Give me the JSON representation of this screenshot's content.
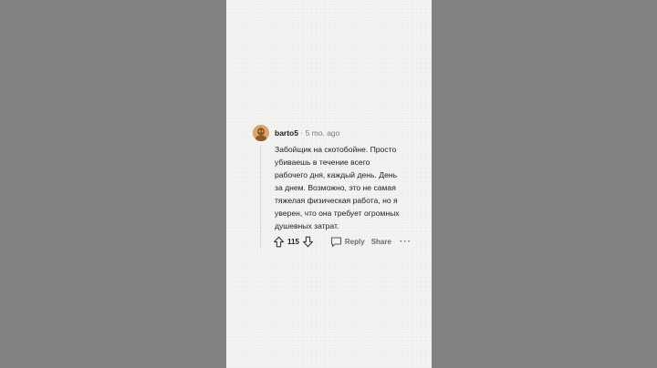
{
  "comment": {
    "username": "barto5",
    "separator": "·",
    "age": "5 mo. ago",
    "body_lines": [
      "Забойщик на скотобойне. Просто",
      "убиваешь в течение всего",
      "рабочего дня, каждый день. День",
      "за днем. Возможно, это не самая",
      "тяжелая физическая работа, но я",
      "уверен, что она требует огромных",
      "душевных затрат."
    ],
    "score": "115",
    "reply_label": "Reply",
    "share_label": "Share",
    "more_label": "···"
  },
  "icons": {
    "avatar": "user-avatar-icon",
    "upvote": "arrow-up-icon",
    "downvote": "arrow-down-icon",
    "reply": "speech-bubble-icon",
    "more": "ellipsis-icon"
  },
  "colors": {
    "background": "#818181",
    "panel": "#f4f4f2",
    "avatar": "#e0a36a",
    "text": "#1c1c1c",
    "muted": "#7a7a7a"
  }
}
